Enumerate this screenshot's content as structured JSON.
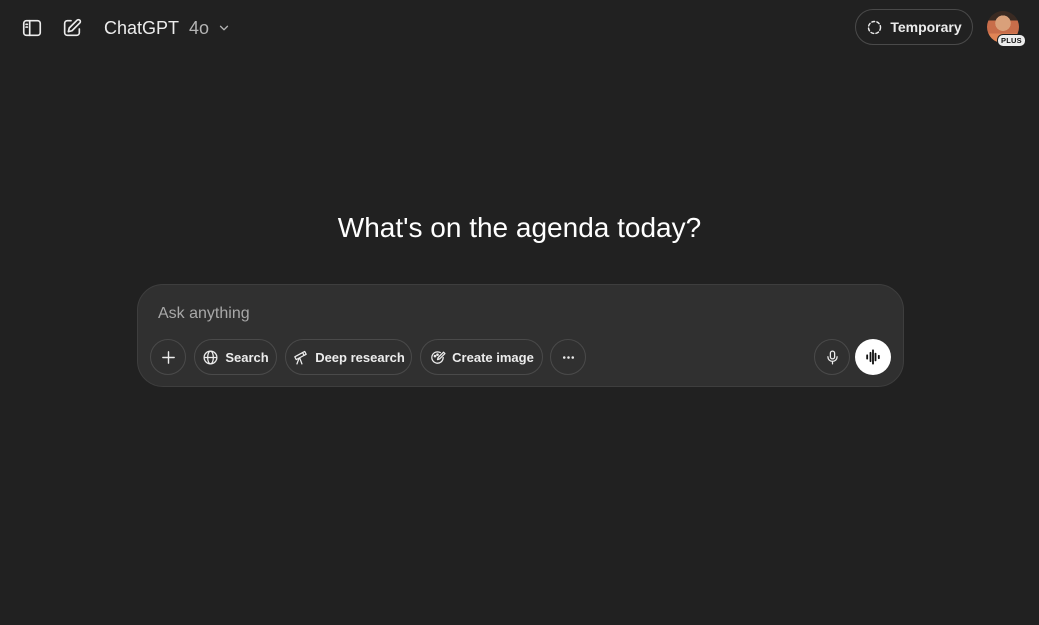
{
  "header": {
    "model_name": "ChatGPT",
    "model_version": "4o",
    "temporary_label": "Temporary",
    "plan_badge": "PLUS"
  },
  "main": {
    "heading": "What's on the agenda today?"
  },
  "composer": {
    "placeholder": "Ask anything",
    "value": "",
    "tools": {
      "search_label": "Search",
      "deep_research_label": "Deep research",
      "create_image_label": "Create image"
    }
  },
  "icons": {
    "sidebar": "sidebar-toggle-icon",
    "new_chat": "edit-pencil-icon",
    "chevron": "chevron-down-icon",
    "temporary": "dashed-circle-icon",
    "plus": "plus-icon",
    "search": "globe-icon",
    "deep_research": "telescope-icon",
    "create_image": "palette-icon",
    "more": "ellipsis-icon",
    "mic": "microphone-icon",
    "voice": "voice-wave-icon"
  },
  "colors": {
    "background": "#212121",
    "composer_bg": "#303030",
    "border": "#4a4a4a",
    "text": "#ececec",
    "muted": "#b4b4b4",
    "voice_button": "#ffffff"
  }
}
